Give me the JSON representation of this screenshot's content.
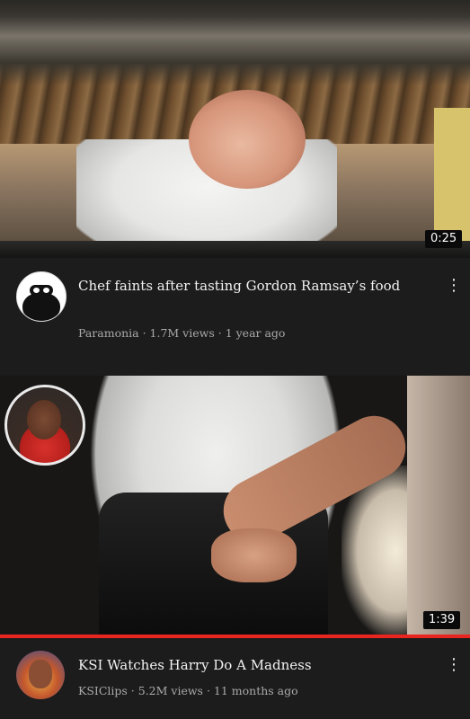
{
  "videos": [
    {
      "title": "Chef faints after tasting Gordon Ramsay’s food",
      "channel": "Paramonia",
      "views": "1.7M views",
      "age": "1 year ago",
      "duration": "0:25",
      "avatar_icon": "ninja-mask-avatar",
      "menu_icon": "more-vert-icon"
    },
    {
      "title": "KSI Watches Harry Do A Madness",
      "channel": "KSIClips",
      "views": "5.2M views",
      "age": "11 months ago",
      "duration": "1:39",
      "avatar_icon": "person-avatar",
      "menu_icon": "more-vert-icon",
      "progress": 1.0
    }
  ],
  "separator": " · ",
  "colors": {
    "background": "#1c1c1c",
    "progress": "#e8251e",
    "title_text": "#f1f1f1",
    "meta_text": "#a9a9a9"
  }
}
